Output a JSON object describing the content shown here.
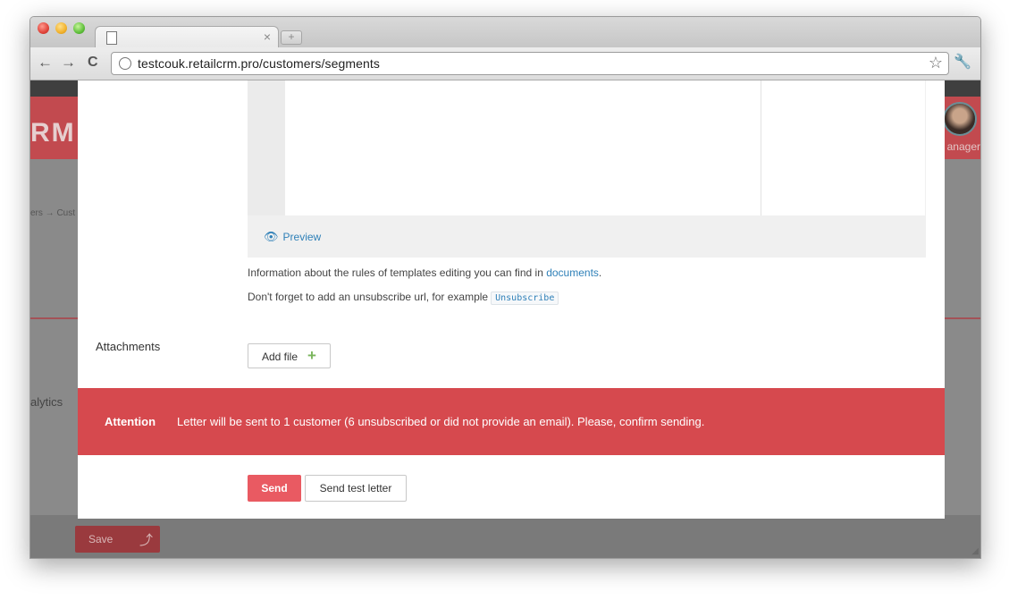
{
  "browser": {
    "url": "testcouk.retailcrm.pro/customers/segments",
    "tab_close": "×",
    "new_tab": "+",
    "back": "←",
    "forward": "→",
    "reload": "C",
    "star": "☆",
    "wrench": "🔧"
  },
  "background": {
    "logo": "RM",
    "manager": "anager",
    "breadcrumb": "ers → Cust",
    "analytics": "alytics",
    "save_label": "Save",
    "save_arrow": "⤴"
  },
  "modal": {
    "preview_label": "Preview",
    "info_line1_prefix": "Information about the rules of templates editing you can find in ",
    "info_line1_link": "documents",
    "info_line1_suffix": ".",
    "info_line2": "Don't forget to add an unsubscribe url, for example",
    "unsubscribe_code": "Unsubscribe",
    "attachments_label": "Attachments",
    "add_file_label": "Add file",
    "add_file_plus": "+",
    "attention_title": "Attention",
    "attention_text": "Letter will be sent to 1 customer (6 unsubscribed or did not provide an email). Please, confirm sending.",
    "send_label": "Send",
    "send_test_label": "Send test letter"
  },
  "colors": {
    "accent": "#e95a62",
    "attention_bg": "#d6494e",
    "link": "#2f80b8"
  }
}
